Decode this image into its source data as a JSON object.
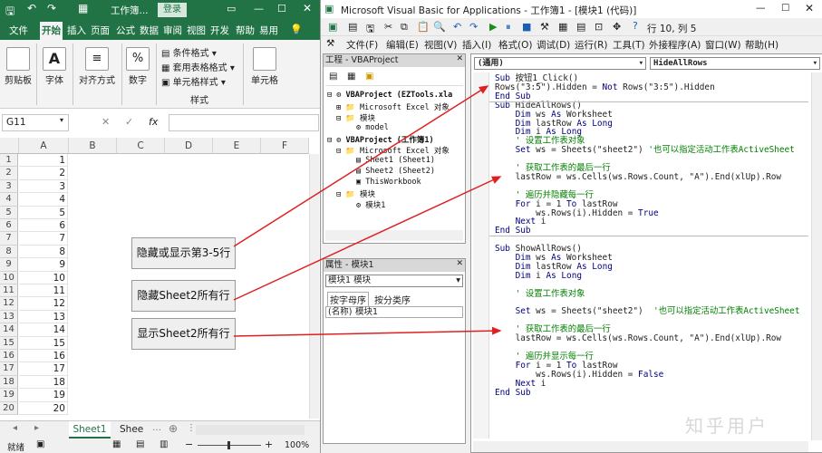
{
  "excel": {
    "title": "工作簿...",
    "login": "登录",
    "tabs": [
      "文件",
      "开始",
      "插入",
      "页面",
      "公式",
      "数据",
      "审阅",
      "视图",
      "开发",
      "帮助",
      "易用"
    ],
    "ribbon": {
      "paste": "剪贴板",
      "font": "字体",
      "align": "对齐方式",
      "number": "数字",
      "cond": "条件格式",
      "table_fmt": "套用表格格式",
      "cell_style": "单元格样式",
      "style_group": "样式",
      "cells": "单元格"
    },
    "namebox": "G11",
    "fx": "fx",
    "columns": [
      "A",
      "B",
      "C",
      "D",
      "E",
      "F"
    ],
    "rows": [
      "1",
      "2",
      "3",
      "4",
      "5",
      "6",
      "7",
      "8",
      "9",
      "10",
      "11",
      "12",
      "13",
      "14",
      "15",
      "16",
      "17",
      "18",
      "19",
      "20"
    ],
    "colA": [
      "1",
      "2",
      "3",
      "4",
      "5",
      "6",
      "7",
      "8",
      "9",
      "10",
      "11",
      "12",
      "13",
      "14",
      "15",
      "16",
      "17",
      "18",
      "19",
      "20"
    ],
    "buttons": [
      "隐藏或显示第3-5行",
      "隐藏Sheet2所有行",
      "显示Sheet2所有行"
    ],
    "sheets": [
      "Sheet1",
      "Shee"
    ],
    "status": "就绪",
    "zoom": "100%"
  },
  "vba": {
    "title": "Microsoft Visual Basic for Applications - 工作簿1 - [模块1 (代码)]",
    "position": "行 10, 列 5",
    "menu": [
      "文件(F)",
      "编辑(E)",
      "视图(V)",
      "插入(I)",
      "格式(O)",
      "调试(D)",
      "运行(R)",
      "工具(T)",
      "外接程序(A)",
      "窗口(W)",
      "帮助(H)"
    ],
    "project_title": "工程 - VBAProject",
    "tree": [
      "VBAProject (EZTools.xla",
      "Microsoft Excel 对象",
      "模块",
      "model",
      "VBAProject (工作簿1)",
      "Microsoft Excel 对象",
      "Sheet1 (Sheet1)",
      "Sheet2 (Sheet2)",
      "ThisWorkbook",
      "模块",
      "模块1"
    ],
    "props_title": "属性 - 模块1",
    "props_combo": "模块1 模块",
    "props_tabs": [
      "按字母序",
      "按分类序"
    ],
    "props_row": [
      "(名称)",
      "模块1"
    ],
    "combo_left": "(通用)",
    "combo_right": "HideAllRows",
    "code": [
      "Sub 按钮1_Click()",
      "Rows(\"3:5\").Hidden = Not Rows(\"3:5\").Hidden",
      "End Sub",
      "Sub HideAllRows()",
      "    Dim ws As Worksheet",
      "    Dim lastRow As Long",
      "    Dim i As Long",
      "    ' 设置工作表对象",
      "    Set ws = Sheets(\"sheet2\") '也可以指定活动工作表ActiveSheet",
      "",
      "    ' 获取工作表的最后一行",
      "    lastRow = ws.Cells(ws.Rows.Count, \"A\").End(xlUp).Row",
      "",
      "    ' 遍历并隐藏每一行",
      "    For i = 1 To lastRow",
      "        ws.Rows(i).Hidden = True",
      "    Next i",
      "End Sub",
      "",
      "Sub ShowAllRows()",
      "    Dim ws As Worksheet",
      "    Dim lastRow As Long",
      "    Dim i As Long",
      "",
      "    ' 设置工作表对象",
      "",
      "    Set ws = Sheets(\"sheet2\")  '也可以指定活动工作表ActiveSheet",
      "",
      "    ' 获取工作表的最后一行",
      "    lastRow = ws.Cells(ws.Rows.Count, \"A\").End(xlUp).Row",
      "",
      "    ' 遍历并显示每一行",
      "    For i = 1 To lastRow",
      "        ws.Rows(i).Hidden = False",
      "    Next i",
      "End Sub"
    ]
  },
  "watermark": "知乎用户",
  "colors": {
    "excel_green": "#217346",
    "arrow": "#e02020",
    "keyword": "#00007f",
    "comment": "#007f00"
  }
}
